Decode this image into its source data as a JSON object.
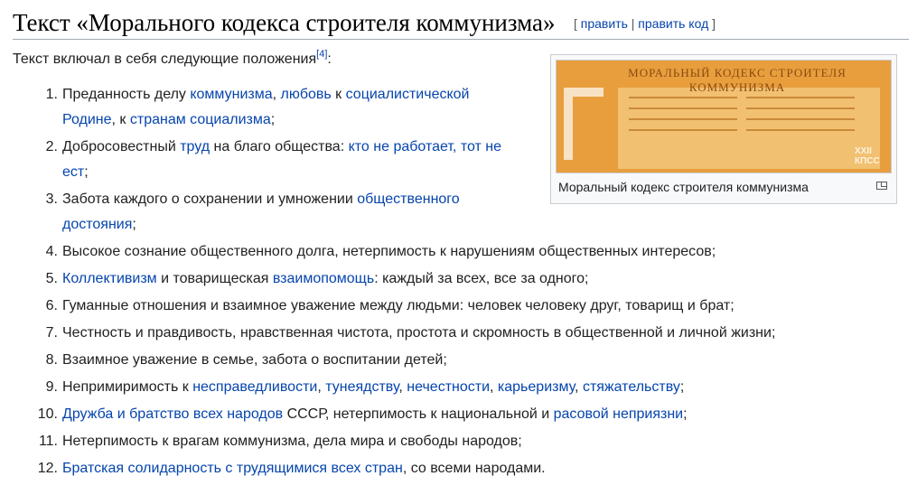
{
  "heading": {
    "title": "Текст «Морального кодекса строителя коммунизма»",
    "edit_open": "[ ",
    "edit": "править",
    "sep": " | ",
    "edit_code": "править код",
    "edit_close": " ]"
  },
  "intro": {
    "text": "Текст включал в себя следующие положения",
    "ref": "[4]",
    "colon": ":"
  },
  "thumb": {
    "image_title": "МОРАЛЬНЫЙ КОДЕКС СТРОИТЕЛЯ КОММУНИЗМА",
    "emblem_text": "XXII КПСС",
    "caption": "Моральный кодекс строителя коммунизма",
    "icon": "enlarge-icon"
  },
  "items": [
    {
      "num": "1.",
      "parts": [
        {
          "t": "Преданность делу "
        },
        {
          "t": "коммунизма",
          "link": true
        },
        {
          "t": ", "
        },
        {
          "t": "любовь",
          "link": true
        },
        {
          "t": " к "
        },
        {
          "t": "социалистической Родине",
          "link": true
        },
        {
          "t": ", к "
        },
        {
          "t": "странам социализма",
          "link": true
        },
        {
          "t": ";"
        }
      ]
    },
    {
      "num": "2.",
      "parts": [
        {
          "t": "Добросовестный "
        },
        {
          "t": "труд",
          "link": true
        },
        {
          "t": " на благо общества: "
        },
        {
          "t": "кто не работает, тот не ест",
          "link": true
        },
        {
          "t": ";"
        }
      ]
    },
    {
      "num": "3.",
      "parts": [
        {
          "t": "Забота каждого о сохранении и умножении "
        },
        {
          "t": "общественного достояния",
          "link": true
        },
        {
          "t": ";"
        }
      ]
    },
    {
      "num": "4.",
      "parts": [
        {
          "t": "Высокое сознание общественного долга, нетерпимость к нарушениям общественных интересов;"
        }
      ]
    },
    {
      "num": "5.",
      "parts": [
        {
          "t": "Коллективизм",
          "link": true
        },
        {
          "t": " и товарищеская "
        },
        {
          "t": "взаимопомощь",
          "link": true
        },
        {
          "t": ": каждый за всех, все за одного;"
        }
      ]
    },
    {
      "num": "6.",
      "parts": [
        {
          "t": "Гуманные отношения и взаимное уважение между людьми: человек человеку друг, товарищ и брат;"
        }
      ]
    },
    {
      "num": "7.",
      "parts": [
        {
          "t": "Честность и правдивость, нравственная чистота, простота и скромность в общественной и личной жизни;"
        }
      ]
    },
    {
      "num": "8.",
      "parts": [
        {
          "t": "Взаимное уважение в семье, забота о воспитании детей;"
        }
      ]
    },
    {
      "num": "9.",
      "parts": [
        {
          "t": "Непримиримость к "
        },
        {
          "t": "несправедливости",
          "link": true
        },
        {
          "t": ", "
        },
        {
          "t": "тунеядству",
          "link": true
        },
        {
          "t": ", "
        },
        {
          "t": "нечестности",
          "link": true
        },
        {
          "t": ", "
        },
        {
          "t": "карьеризму",
          "link": true
        },
        {
          "t": ", "
        },
        {
          "t": "стяжательству",
          "link": true
        },
        {
          "t": ";"
        }
      ]
    },
    {
      "num": "10.",
      "parts": [
        {
          "t": "Дружба и братство всех народов",
          "link": true
        },
        {
          "t": " СССР, нетерпимость к национальной и "
        },
        {
          "t": "расовой неприязни",
          "link": true
        },
        {
          "t": ";"
        }
      ]
    },
    {
      "num": "11.",
      "parts": [
        {
          "t": "Нетерпимость к врагам коммунизма, дела мира и свободы народов;"
        }
      ]
    },
    {
      "num": "12.",
      "parts": [
        {
          "t": "Братская солидарность с трудящимися всех стран",
          "link": true
        },
        {
          "t": ", со всеми народами."
        }
      ]
    }
  ],
  "colors": {
    "link": "#0645ad",
    "text": "#202122",
    "border": "#a2a9b1"
  }
}
